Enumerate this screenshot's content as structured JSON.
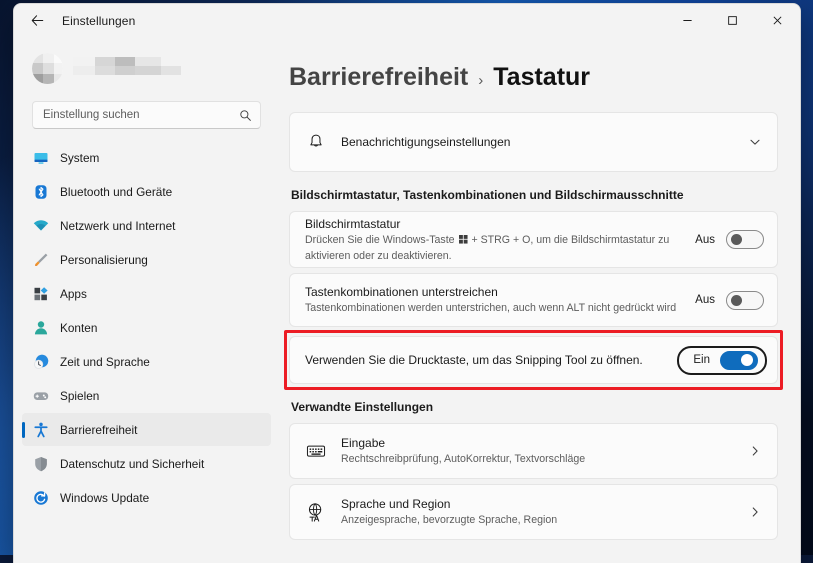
{
  "window": {
    "title": "Einstellungen",
    "back_icon": "back-arrow-icon",
    "minimize_label": "—",
    "maximize_label": "□",
    "close_label": "✕"
  },
  "sidebar": {
    "search": {
      "placeholder": "Einstellung suchen",
      "icon": "search-icon"
    },
    "items": [
      {
        "label": "System",
        "icon": "monitor-icon",
        "active": false
      },
      {
        "label": "Bluetooth und Geräte",
        "icon": "bluetooth-icon",
        "active": false
      },
      {
        "label": "Netzwerk und Internet",
        "icon": "wifi-icon",
        "active": false
      },
      {
        "label": "Personalisierung",
        "icon": "paintbrush-icon",
        "active": false
      },
      {
        "label": "Apps",
        "icon": "apps-icon",
        "active": false
      },
      {
        "label": "Konten",
        "icon": "person-icon",
        "active": false
      },
      {
        "label": "Zeit und Sprache",
        "icon": "clock-globe-icon",
        "active": false
      },
      {
        "label": "Spielen",
        "icon": "gamepad-icon",
        "active": false
      },
      {
        "label": "Barrierefreiheit",
        "icon": "accessibility-icon",
        "active": true
      },
      {
        "label": "Datenschutz und Sicherheit",
        "icon": "shield-icon",
        "active": false
      },
      {
        "label": "Windows Update",
        "icon": "update-icon",
        "active": false
      }
    ]
  },
  "breadcrumb": {
    "parent": "Barrierefreiheit",
    "separator": "›",
    "current": "Tastatur"
  },
  "notification_card": {
    "icon": "bell-icon",
    "label": "Benachrichtigungseinstellungen",
    "expander_icon": "chevron-down-icon"
  },
  "keyboard_section": {
    "header": "Bildschirmtastatur, Tastenkombinationen und Bildschirmausschnitte",
    "rows": [
      {
        "title": "Bildschirmtastatur",
        "description_before": "Drücken Sie die Windows-Taste",
        "description_after": "+ STRG + O, um die Bildschirmtastatur zu aktivieren oder zu deaktivieren.",
        "state_label": "Aus",
        "state_on": false
      },
      {
        "title": "Tastenkombinationen unterstreichen",
        "description": "Tastenkombinationen werden unterstrichen, auch wenn ALT nicht gedrückt wird",
        "state_label": "Aus",
        "state_on": false
      }
    ],
    "highlighted_row": {
      "title": "Verwenden Sie die Drucktaste, um das Snipping Tool zu öffnen.",
      "state_label": "Ein",
      "state_on": true,
      "annotation_color": "#ec1c24"
    }
  },
  "related_section": {
    "header": "Verwandte Einstellungen",
    "rows": [
      {
        "icon": "keyboard-icon",
        "title": "Eingabe",
        "description": "Rechtschreibprüfung, AutoKorrektur, Textvorschläge",
        "chevron_icon": "chevron-right-icon"
      },
      {
        "icon": "language-globe-icon",
        "title": "Sprache und Region",
        "description": "Anzeigesprache, bevorzugte Sprache, Region",
        "chevron_icon": "chevron-right-icon"
      }
    ]
  },
  "colors": {
    "accent": "#0f6cbd",
    "selection_bar": "#0067c0",
    "annotation": "#ec1c24",
    "window_bg": "#f3f3f3",
    "card_bg": "#fbfbfb"
  }
}
